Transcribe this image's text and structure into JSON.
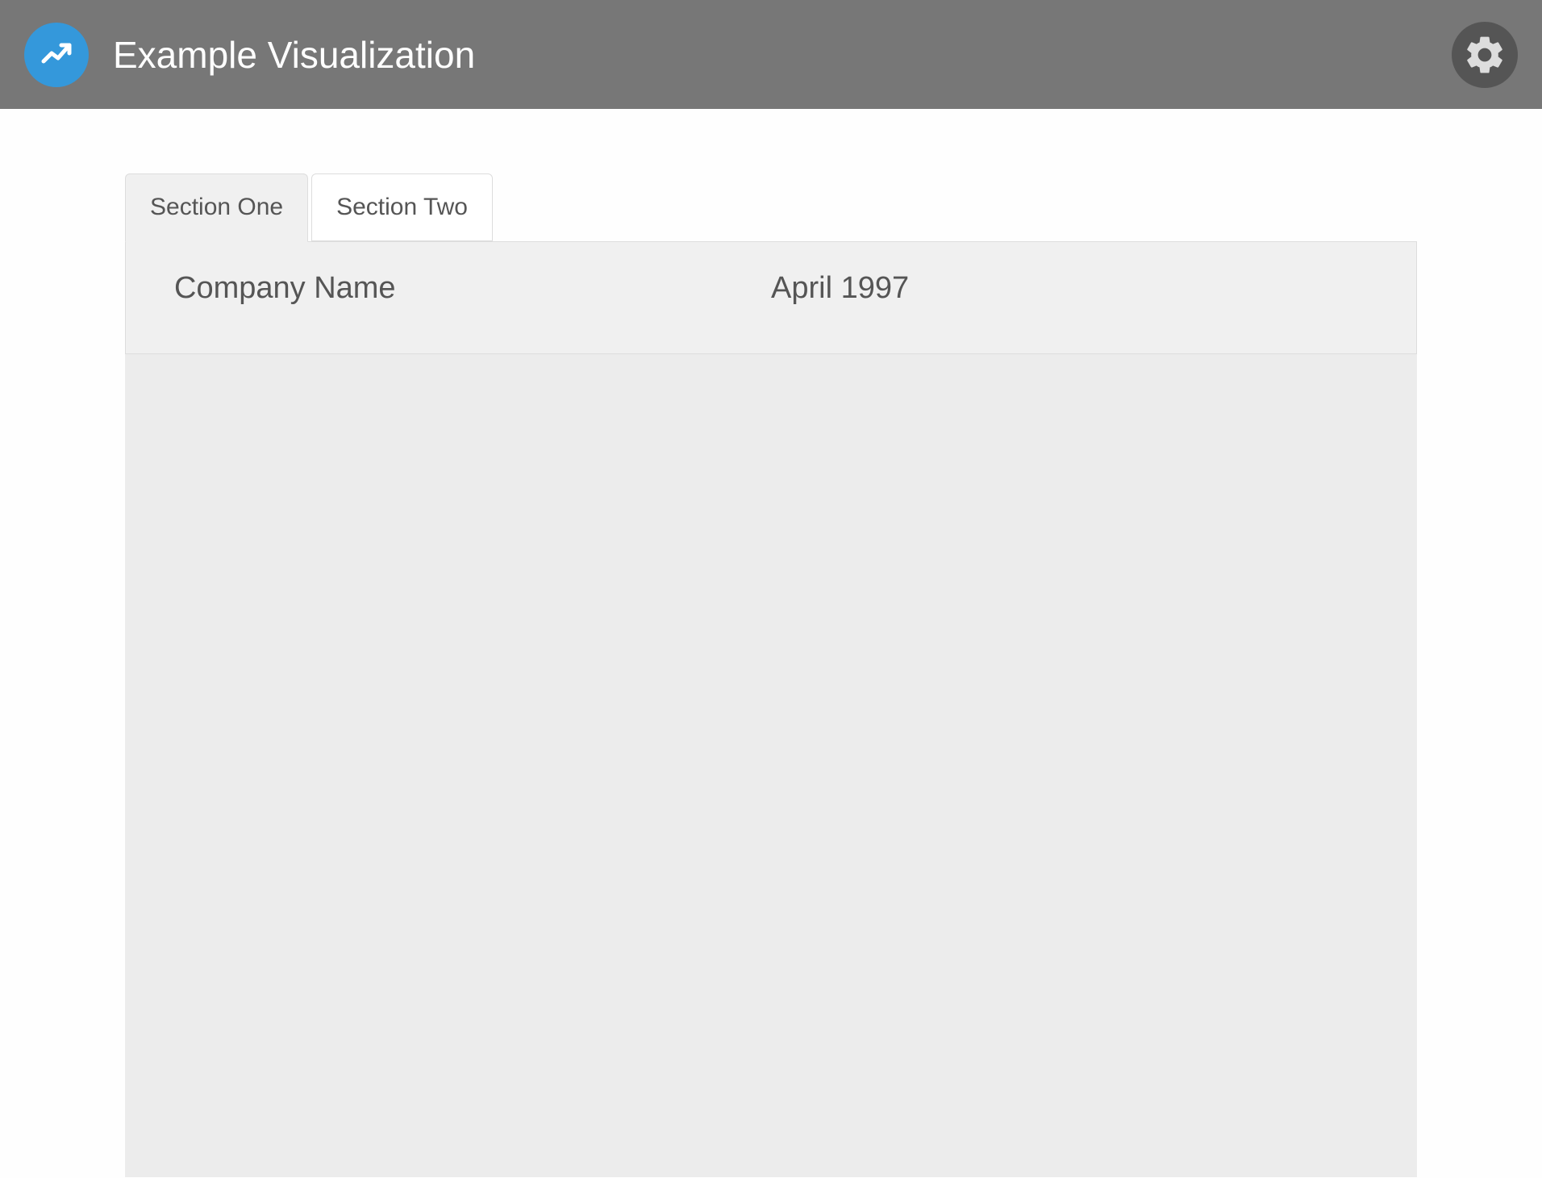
{
  "header": {
    "title": "Example Visualization"
  },
  "tabs": [
    {
      "label": "Section One",
      "active": true
    },
    {
      "label": "Section Two",
      "active": false
    }
  ],
  "content": {
    "label": "Company Name",
    "value": "April 1997"
  }
}
